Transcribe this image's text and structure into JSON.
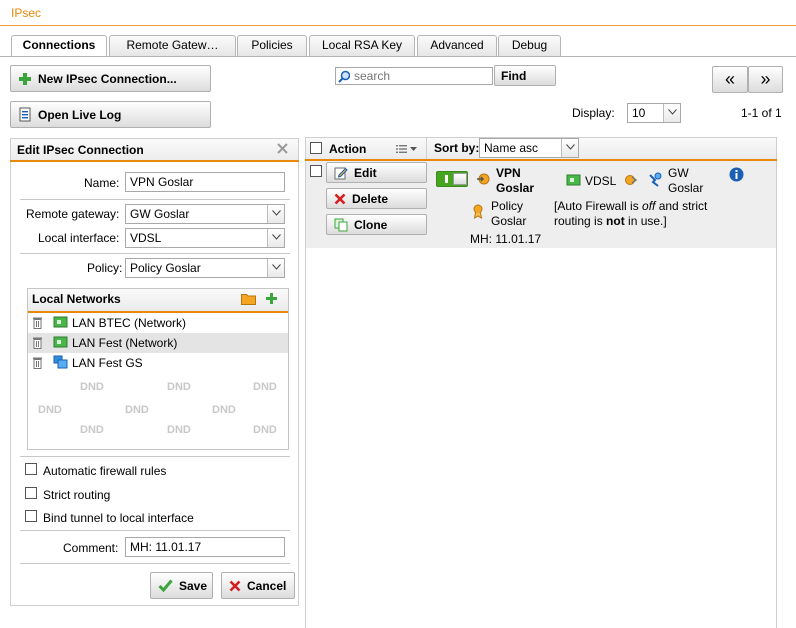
{
  "header": {
    "title": "IPsec"
  },
  "tabs": [
    "Connections",
    "Remote Gatew…",
    "Policies",
    "Local RSA Key",
    "Advanced",
    "Debug"
  ],
  "toolbar": {
    "new_connection": "New IPsec Connection...",
    "open_live_log": "Open Live Log",
    "search_placeholder": "search",
    "find": "Find",
    "prev": "«",
    "next": "»",
    "display_label": "Display:",
    "display_value": "10",
    "page_info": "1-1 of 1"
  },
  "edit": {
    "title": "Edit IPsec Connection",
    "name_label": "Name:",
    "name_value": "VPN Goslar",
    "remote_gateway_label": "Remote gateway:",
    "remote_gateway_value": "GW Goslar",
    "local_interface_label": "Local interface:",
    "local_interface_value": "VDSL",
    "policy_label": "Policy:",
    "policy_value": "Policy Goslar",
    "local_networks_title": "Local Networks",
    "networks": [
      "LAN BTEC (Network)",
      "LAN Fest (Network)",
      "LAN Fest GS"
    ],
    "dnd": "DND",
    "auto_fw": "Automatic firewall rules",
    "strict_routing": "Strict routing",
    "bind_tunnel": "Bind tunnel to local interface",
    "comment_label": "Comment:",
    "comment_value": "MH: 11.01.17",
    "save": "Save",
    "cancel": "Cancel"
  },
  "grid": {
    "action_label": "Action",
    "sort_label": "Sort by:",
    "sort_value": "Name asc",
    "edit": "Edit",
    "delete": "Delete",
    "clone": "Clone",
    "conn_name_1": "VPN",
    "conn_name_2": "Goslar",
    "interface": "VDSL",
    "gw_1": "GW",
    "gw_2": "Goslar",
    "policy_1": "Policy",
    "policy_2": "Goslar",
    "note_1": "[Auto Firewall is ",
    "note_off": "off",
    "note_2": " and strict",
    "note_3": "routing is ",
    "note_not": "not",
    "note_4": " in use.]",
    "comment": "MH: 11.01.17"
  },
  "colors": {
    "accent": "#e8890c",
    "green": "#3aa53a",
    "red": "#d22020",
    "info": "#1a5fb4"
  }
}
